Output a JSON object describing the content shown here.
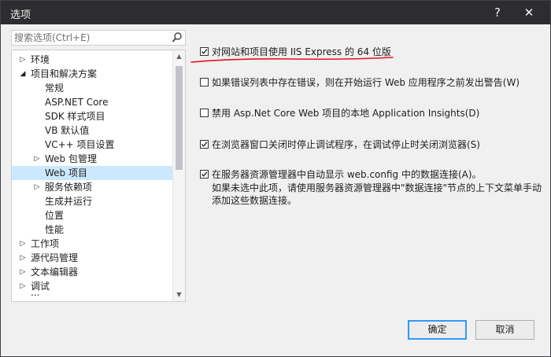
{
  "window": {
    "title": "选项",
    "help": "?",
    "close": "✕"
  },
  "search": {
    "placeholder": "搜索选项(Ctrl+E)"
  },
  "tree": {
    "items": [
      {
        "label": "环境",
        "arrow": "▷"
      },
      {
        "label": "项目和解决方案",
        "arrow": "◢"
      },
      {
        "label": "常规"
      },
      {
        "label": "ASP.NET Core"
      },
      {
        "label": "SDK 样式项目"
      },
      {
        "label": "VB 默认值"
      },
      {
        "label": "VC++ 项目设置"
      },
      {
        "label": "Web 包管理",
        "arrow": "▷"
      },
      {
        "label": "Web 项目",
        "selected": true
      },
      {
        "label": "服务依赖项",
        "arrow": "▷"
      },
      {
        "label": "生成并运行"
      },
      {
        "label": "位置"
      },
      {
        "label": "性能"
      },
      {
        "label": "工作项",
        "arrow": "▷"
      },
      {
        "label": "源代码管理",
        "arrow": "▷"
      },
      {
        "label": "文本编辑器",
        "arrow": "▷"
      },
      {
        "label": "调试",
        "arrow": "▷"
      },
      {
        "label": "..."
      }
    ]
  },
  "options": [
    {
      "label": "对网站和项目使用 IIS Express 的 64 位版",
      "checked": true
    },
    {
      "label": "如果错误列表中存在错误，则在开始运行 Web 应用程序之前发出警告(W)",
      "checked": false
    },
    {
      "label": "禁用 Asp.Net Core Web 项目的本地 Application Insights(D)",
      "checked": false
    },
    {
      "label": "在浏览器窗口关闭时停止调试程序，在调试停止时关闭浏览器(S)",
      "checked": true
    },
    {
      "label": "在服务器资源管理器中自动显示 web.config 中的数据连接(A)。",
      "checked": true,
      "description": "如果未选中此项，请使用服务器资源管理器中\"数据连接\"节点的上下文菜单手动添加这些数据连接。"
    }
  ],
  "buttons": {
    "ok": "确定",
    "cancel": "取消"
  },
  "colors": {
    "selection": "#cce8ff",
    "primary_border": "#3399ff",
    "annotation": "#e81123"
  }
}
